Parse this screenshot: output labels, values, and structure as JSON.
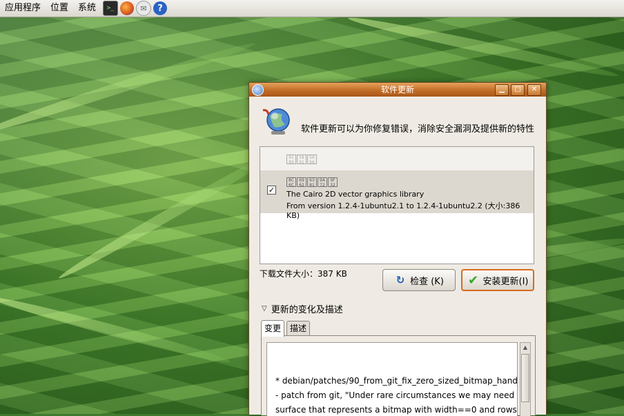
{
  "panel": {
    "menus": [
      "应用程序",
      "位置",
      "系统"
    ],
    "launchers": [
      "terminal-icon",
      "firefox-icon",
      "mail-icon",
      "help-icon"
    ]
  },
  "window": {
    "title": "软件更新",
    "header_text": "软件更新可以为你修复错误，消除安全漏洞及提供新的特性",
    "group_label_glyphs": [
      "91 89\nC0 81",
      "58 91\n8B 81",
      "56 66\nF4 8B"
    ],
    "update": {
      "name_glyphs": [
        "8C 6C",
        "69 62",
        "63 81",
        "9A 72",
        "9F 32"
      ],
      "checked": true,
      "description": "The Cairo 2D vector graphics library",
      "version": "From version 1.2.4-1ubuntu2.1 to 1.2.4-1ubuntu2.2 (大小:386 KB)"
    },
    "download_size": "下载文件大小：387 KB",
    "check_button": "检查 (K)",
    "install_button": "安装更新(I)",
    "expander_label": "更新的变化及描述",
    "tabs": [
      "变更",
      "描述"
    ],
    "changelog": [
      "* debian/patches/90_from_git_fix_zero_sized_bitmap_hand",
      "  - patch from git, \"Under rare circumstances we may need",
      "    surface that represents a bitmap with width==0 and rows"
    ]
  },
  "colors": {
    "titlebar": "#c26d27",
    "install_border": "#d96a1b",
    "selected_row": "#ddd8cf"
  }
}
